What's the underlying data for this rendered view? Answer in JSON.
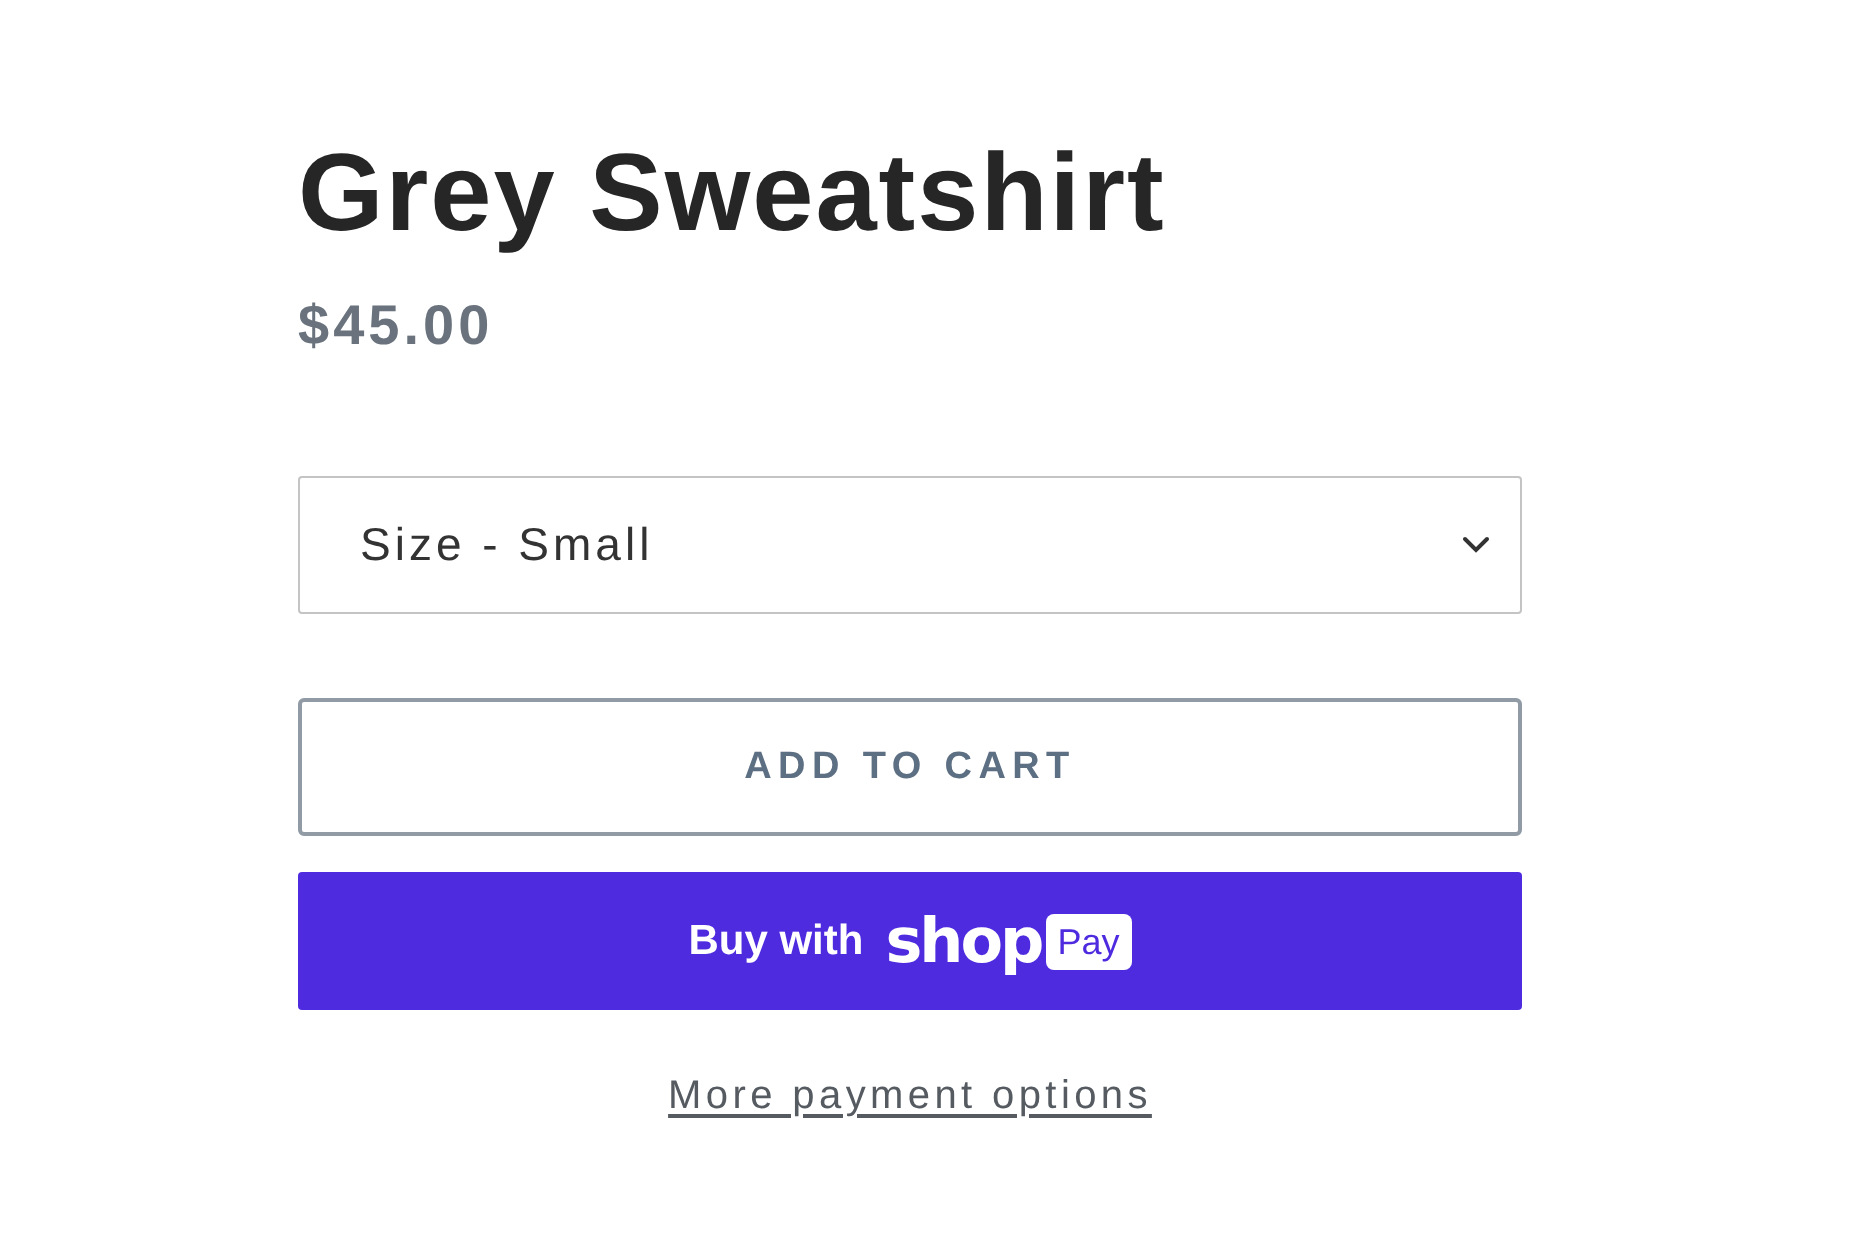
{
  "product": {
    "title": "Grey Sweatshirt",
    "price": "$45.00"
  },
  "variant_select": {
    "value": "Size - Small"
  },
  "add_to_cart_button": {
    "label": "ADD TO CART"
  },
  "shop_pay_button": {
    "label": "Buy with",
    "logo_text": "shop",
    "badge": "Pay"
  },
  "more_payment_link": {
    "label": "More payment options"
  }
}
